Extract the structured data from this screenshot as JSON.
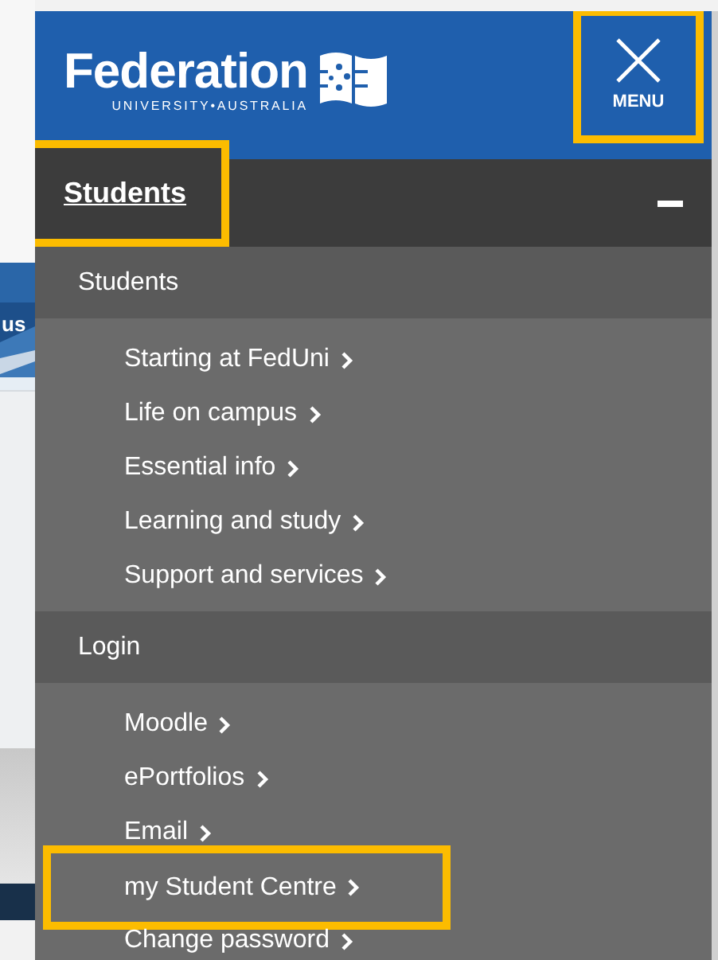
{
  "background_page": {
    "text_fragment": "us"
  },
  "header": {
    "logo": {
      "name": "Federation",
      "tagline": "UNIVERSITY•AUSTRALIA"
    },
    "menu_button": {
      "label": "MENU",
      "highlighted": true
    }
  },
  "nav": {
    "heading": {
      "label": "Students",
      "expanded": true,
      "highlighted": true
    },
    "sections": [
      {
        "label": "Students",
        "items": [
          {
            "label": "Starting at FedUni",
            "highlighted": false
          },
          {
            "label": "Life on campus",
            "highlighted": false
          },
          {
            "label": "Essential info",
            "highlighted": false
          },
          {
            "label": "Learning and study",
            "highlighted": false
          },
          {
            "label": "Support and services",
            "highlighted": false
          }
        ]
      },
      {
        "label": "Login",
        "items": [
          {
            "label": "Moodle",
            "highlighted": false
          },
          {
            "label": "ePortfolios",
            "highlighted": false
          },
          {
            "label": "Email",
            "highlighted": false
          },
          {
            "label": "my Student Centre",
            "highlighted": true
          },
          {
            "label": "Change password",
            "highlighted": false
          }
        ]
      }
    ]
  }
}
